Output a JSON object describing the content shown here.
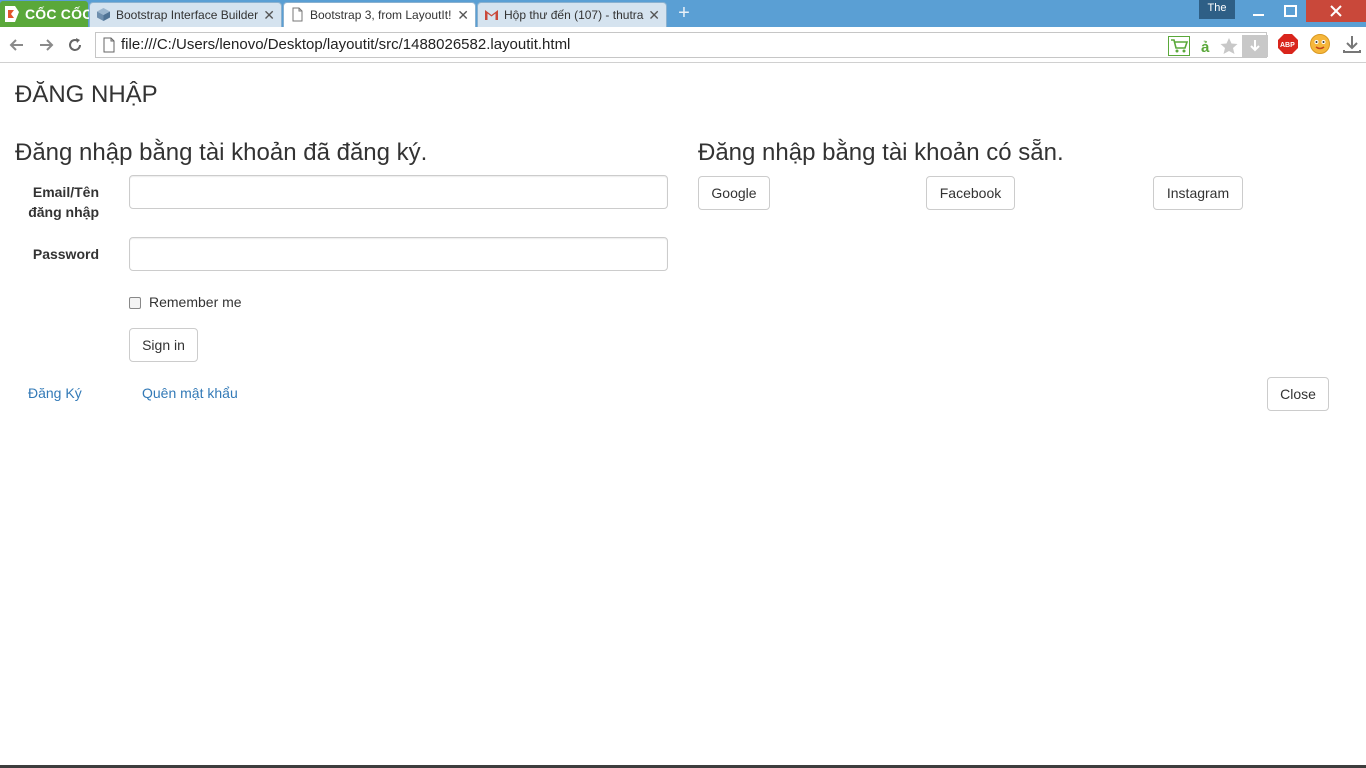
{
  "browser": {
    "brand": "CỐC CỐC",
    "tabs": [
      {
        "label": "Bootstrap Interface Builder",
        "icon": "cube-icon",
        "active": false
      },
      {
        "label": "Bootstrap 3, from LayoutIt!",
        "icon": "page-icon",
        "active": true
      },
      {
        "label": "Hộp thư đến (107) - thutra",
        "icon": "gmail-icon",
        "active": false
      }
    ],
    "tab_close": "✕",
    "new_tab": "+",
    "profile": "The",
    "url": "file:///C:/Users/lenovo/Desktop/layoutit/src/1488026582.layoutit.html",
    "accent": "#5a9fd4",
    "brand_color": "#5aa83a"
  },
  "page": {
    "title": "ĐĂNG NHẬP",
    "left_heading": "Đăng nhập bằng tài khoản đã đăng ký.",
    "right_heading": "Đăng nhập bằng tài khoản có sẵn.",
    "email_label": "Email/Tên đăng nhập",
    "email_value": "",
    "password_label": "Password",
    "password_value": "",
    "remember_label": "Remember me",
    "remember_checked": false,
    "signin_label": "Sign in",
    "social": [
      "Google",
      "Facebook",
      "Instagram"
    ],
    "register_link": "Đăng Ký",
    "forgot_link": "Quên mật khẩu",
    "close_label": "Close",
    "link_color": "#337ab7"
  }
}
